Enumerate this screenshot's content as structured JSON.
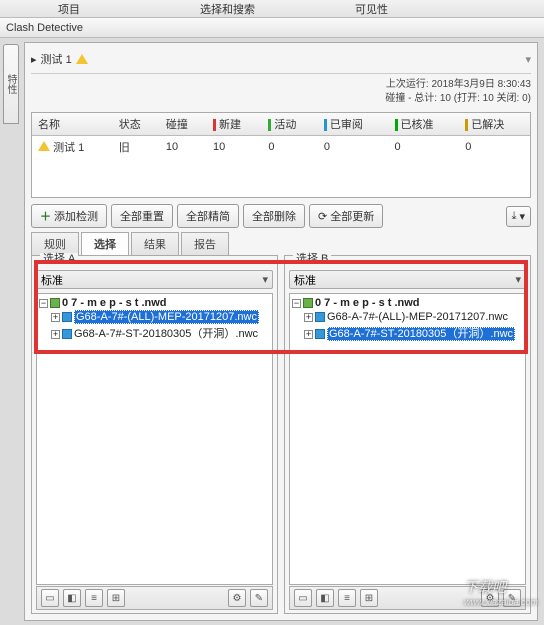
{
  "topbar": {
    "left": "项目",
    "mid": "选择和搜索",
    "right": "可见性",
    "down": "▾"
  },
  "app_title": "Clash Detective",
  "side_tab": "特性",
  "test_title": "测试 1",
  "meta": {
    "last_run": "上次运行: 2018年3月9日 8:30:43",
    "summary": "碰撞 - 总计: 10 (打开: 10  关闭: 0)"
  },
  "grid": {
    "cols": [
      "名称",
      "状态",
      "碰撞",
      "新建",
      "活动",
      "已审阅",
      "已核准",
      "已解决"
    ],
    "row": {
      "name": "测试 1",
      "status": "旧",
      "clash": "10",
      "new": "10",
      "active": "0",
      "review": "0",
      "approved": "0",
      "resolved": "0"
    }
  },
  "buttons": {
    "add": "添加检测",
    "reset": "全部重置",
    "refine": "全部精简",
    "delete": "全部删除",
    "update": "全部更新"
  },
  "subtabs": {
    "rules": "规则",
    "select": "选择",
    "results": "结果",
    "report": "报告"
  },
  "selA": {
    "legend": "选择 A",
    "ph": "标准",
    "root": "0 7 - m e p - s t .nwd",
    "c1": "G68-A-7#-(ALL)-MEP-20171207.nwc",
    "c2": "G68-A-7#-ST-20180305（开洞）.nwc"
  },
  "selB": {
    "legend": "选择 B",
    "ph": "标准",
    "root": "0 7 - m e p - s t .nwd",
    "c1": "G68-A-7#-(ALL)-MEP-20171207.nwc",
    "c2": "G68-A-7#-ST-20180305（开洞）.nwc"
  },
  "watermark": {
    "big": "下载吧",
    "small": "www.xiazaiba.com"
  }
}
